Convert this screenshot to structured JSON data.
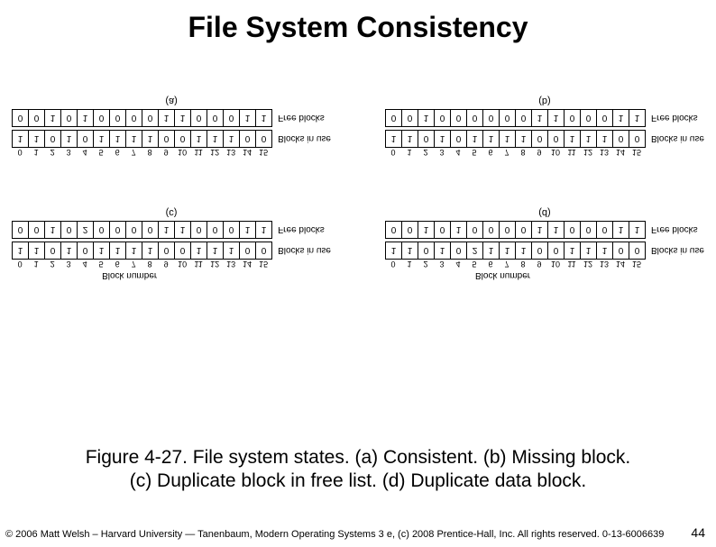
{
  "title": "File System Consistency",
  "figure": {
    "block_caption": "Block number",
    "row_labels": {
      "free": "Free blocks",
      "use": "Blocks in use"
    },
    "panels": [
      {
        "id": "a",
        "label": "(a)",
        "use": [
          1,
          1,
          0,
          1,
          0,
          1,
          1,
          1,
          1,
          0,
          0,
          1,
          1,
          1,
          0,
          0
        ],
        "free": [
          0,
          0,
          1,
          0,
          1,
          0,
          0,
          0,
          0,
          1,
          1,
          0,
          0,
          0,
          1,
          1
        ]
      },
      {
        "id": "b",
        "label": "(b)",
        "use": [
          1,
          1,
          0,
          1,
          0,
          1,
          1,
          1,
          1,
          0,
          0,
          1,
          1,
          1,
          0,
          0
        ],
        "free": [
          0,
          0,
          1,
          0,
          0,
          0,
          0,
          0,
          0,
          1,
          1,
          0,
          0,
          0,
          1,
          1
        ]
      },
      {
        "id": "c",
        "label": "(c)",
        "use": [
          1,
          1,
          0,
          1,
          0,
          1,
          1,
          1,
          1,
          0,
          0,
          1,
          1,
          1,
          0,
          0
        ],
        "free": [
          0,
          0,
          1,
          0,
          2,
          0,
          0,
          0,
          0,
          1,
          1,
          0,
          0,
          0,
          1,
          1
        ]
      },
      {
        "id": "d",
        "label": "(d)",
        "use": [
          1,
          1,
          0,
          1,
          0,
          2,
          1,
          1,
          1,
          0,
          0,
          1,
          1,
          1,
          0,
          0
        ],
        "free": [
          0,
          0,
          1,
          0,
          1,
          0,
          0,
          0,
          0,
          1,
          1,
          0,
          0,
          0,
          1,
          1
        ]
      }
    ],
    "numbers": [
      "0",
      "1",
      "2",
      "3",
      "4",
      "5",
      "6",
      "7",
      "8",
      "9",
      "10",
      "11",
      "12",
      "13",
      "14",
      "15"
    ]
  },
  "caption": {
    "line1": "Figure 4-27. File system states. (a) Consistent. (b) Missing block.",
    "line2": "(c) Duplicate block in free list. (d) Duplicate data block."
  },
  "footer": "© 2006 Matt Welsh – Harvard University — Tanenbaum, Modern Operating Systems 3 e, (c) 2008 Prentice-Hall, Inc. All rights reserved. 0-13-6006639",
  "pagenum": "44"
}
